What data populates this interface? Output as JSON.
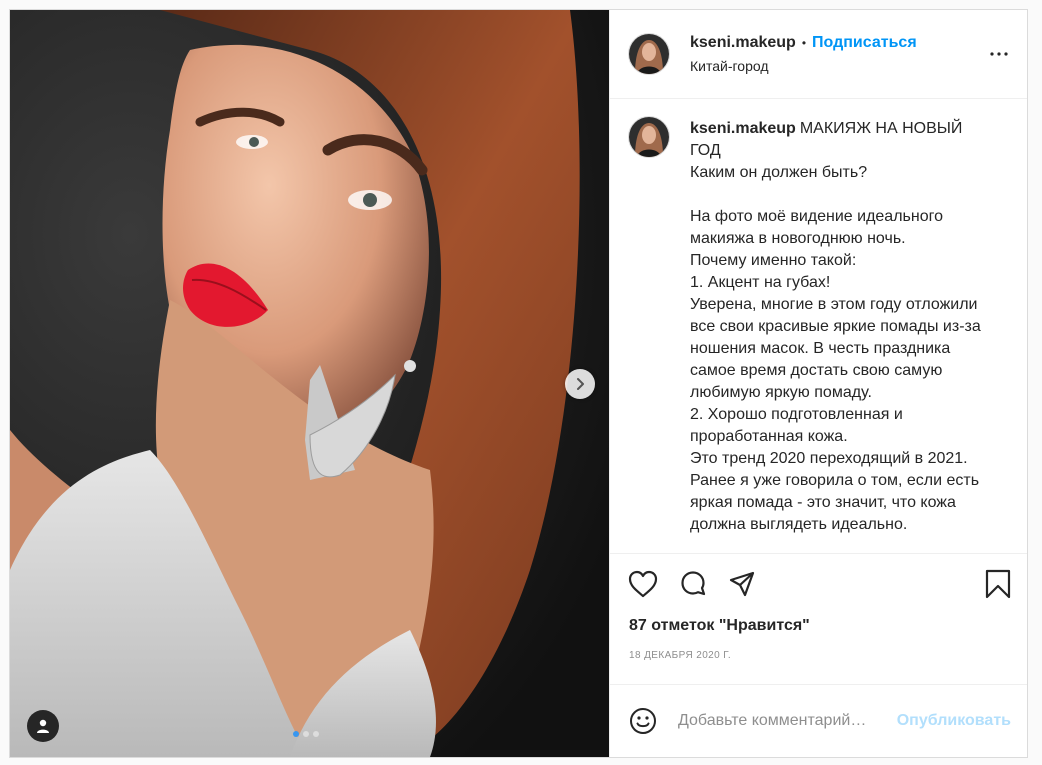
{
  "post": {
    "username": "kseni.makeup",
    "separator": "•",
    "follow_label": "Подписаться",
    "location": "Китай-город",
    "caption_title": "МАКИЯЖ НА НОВЫЙ ГОД",
    "caption_text": "Каким он должен быть?\n\nНа фото моё видение идеального макияжа в новогоднюю ночь.\nПочему именно такой:\n1. Акцент на губах!\nУверена, многие в этом году отложили все свои красивые яркие помады из-за ношения масок. В честь праздника самое время достать свою самую любимую яркую помаду.\n2. Хорошо подготовленная и проработанная кожа.\nЭто тренд 2020 переходящий в 2021. Ранее я уже говорила о том, если есть яркая помада - это значит, что кожа должна выглядеть идеально.",
    "likes": "87 отметок \"Нравится\"",
    "date": "18 ДЕКАБРЯ 2020 Г.",
    "comment_placeholder": "Добавьте комментарий…",
    "publish_label": "Опубликовать",
    "carousel_count": 3,
    "carousel_active": 1
  },
  "colors": {
    "accent": "#0095f6",
    "publish_disabled": "#b2dffc",
    "lips": "#e3182f",
    "hair": "#a2512c"
  },
  "icons": {
    "more": "more-horizontal-icon",
    "like": "heart-icon",
    "comment": "comment-bubble-icon",
    "share": "paper-plane-icon",
    "save": "bookmark-icon",
    "emoji": "smiley-face-icon",
    "next": "chevron-right-icon",
    "tag": "user-tag-icon"
  }
}
